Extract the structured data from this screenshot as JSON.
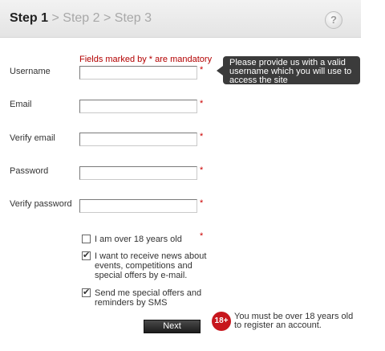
{
  "header": {
    "step1": "Step 1",
    "sep1": ">",
    "step2": "Step 2",
    "sep2": ">",
    "step3": "Step 3",
    "help_icon": "?"
  },
  "form": {
    "mandatory_note": "Fields marked by * are mandatory",
    "required_marker": "*",
    "tooltip": "Please provide us with a valid username which you will use to access the site",
    "fields": [
      {
        "label": "Username",
        "value": ""
      },
      {
        "label": "Email",
        "value": ""
      },
      {
        "label": "Verify email",
        "value": ""
      },
      {
        "label": "Password",
        "value": ""
      },
      {
        "label": "Verify password",
        "value": ""
      }
    ],
    "checkboxes": [
      {
        "label": "I am over 18 years old",
        "checked": false
      },
      {
        "label": "I want to receive news about events, competitions and special offers by e-mail.",
        "checked": true
      },
      {
        "label": "Send me special offers and reminders by SMS",
        "checked": true
      }
    ],
    "next_label": "Next",
    "age_badge": "18+",
    "age_notice": "You must be over 18 years old to register an account."
  },
  "colors": {
    "required": "#cc0000",
    "mandatory_note": "#b30000",
    "badge": "#c7161d",
    "tooltip_bg": "#3b3b3b"
  },
  "icons": {
    "help": "help-icon",
    "checkmark": "checkmark-icon",
    "age_restriction": "age-18-icon"
  }
}
